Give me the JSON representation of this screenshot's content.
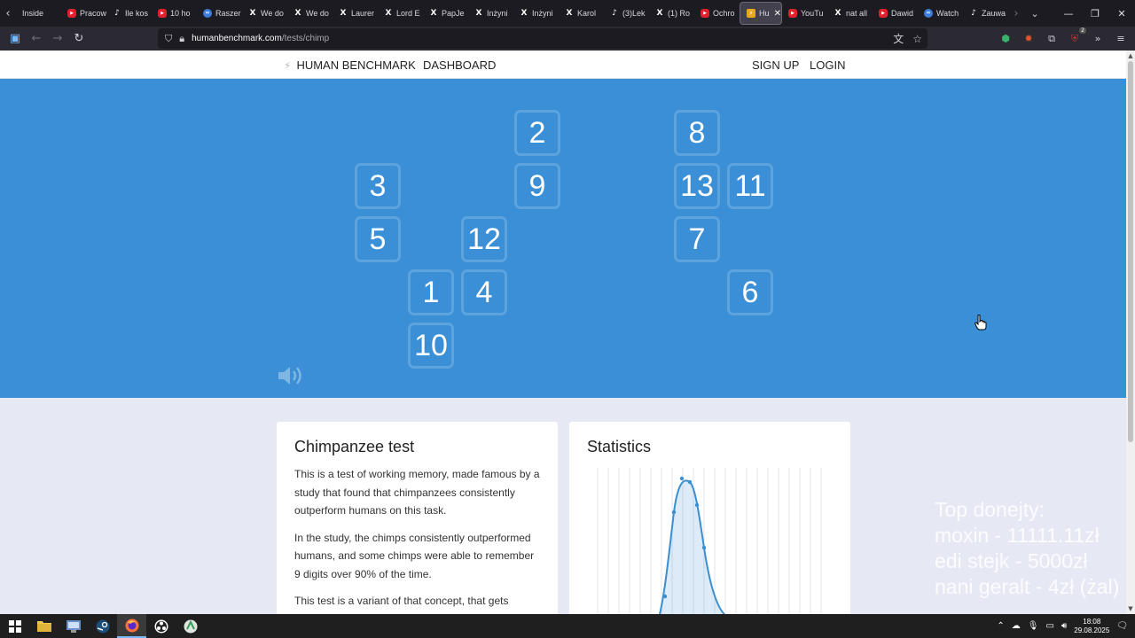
{
  "browser": {
    "tabs": [
      {
        "label": "Inside",
        "icon": "none"
      },
      {
        "label": "Pracow",
        "icon": "yt"
      },
      {
        "label": "Ile kos",
        "icon": "tt"
      },
      {
        "label": "10 ho",
        "icon": "yt"
      },
      {
        "label": "Raszer",
        "icon": "ai"
      },
      {
        "label": "We do",
        "icon": "x"
      },
      {
        "label": "We do",
        "icon": "x"
      },
      {
        "label": "Laurer",
        "icon": "x"
      },
      {
        "label": "Lord E",
        "icon": "x"
      },
      {
        "label": "PapJe",
        "icon": "x"
      },
      {
        "label": "Inżyni",
        "icon": "x"
      },
      {
        "label": "Inżyni",
        "icon": "x"
      },
      {
        "label": "Karol",
        "icon": "x"
      },
      {
        "label": "(3)Lek",
        "icon": "tt"
      },
      {
        "label": "(1) Ro",
        "icon": "x"
      },
      {
        "label": "Ochro",
        "icon": "yt"
      },
      {
        "label": "Hu",
        "icon": "hb",
        "active": true
      },
      {
        "label": "YouTu",
        "icon": "yt"
      },
      {
        "label": "nat all",
        "icon": "x"
      },
      {
        "label": "Dawid",
        "icon": "yt"
      },
      {
        "label": "Watch",
        "icon": "ai"
      },
      {
        "label": "Zauwa",
        "icon": "tt"
      }
    ],
    "url_host": "humanbenchmark.com",
    "url_path": "/tests/chimp",
    "extension_badge": "2"
  },
  "site": {
    "brand": "HUMAN BENCHMARK",
    "nav": {
      "dashboard": "DASHBOARD",
      "signup": "SIGN UP",
      "login": "LOGIN"
    }
  },
  "game": {
    "tiles": [
      {
        "n": "2",
        "col": 5,
        "row": 0
      },
      {
        "n": "8",
        "col": 8,
        "row": 0
      },
      {
        "n": "3",
        "col": 2,
        "row": 1
      },
      {
        "n": "9",
        "col": 5,
        "row": 1
      },
      {
        "n": "13",
        "col": 8,
        "row": 1
      },
      {
        "n": "11",
        "col": 9,
        "row": 1
      },
      {
        "n": "5",
        "col": 2,
        "row": 2
      },
      {
        "n": "12",
        "col": 4,
        "row": 2
      },
      {
        "n": "7",
        "col": 8,
        "row": 2
      },
      {
        "n": "1",
        "col": 3,
        "row": 3
      },
      {
        "n": "4",
        "col": 4,
        "row": 3
      },
      {
        "n": "6",
        "col": 9,
        "row": 3
      },
      {
        "n": "10",
        "col": 3,
        "row": 4
      }
    ]
  },
  "about": {
    "title": "Chimpanzee test",
    "p1": "This is a test of working memory, made famous by a study that found that chimpanzees consistently outperform humans on this task.",
    "p2": "In the study, the chimps consistently outperformed humans, and some chimps were able to remember 9 digits over 90% of the time.",
    "p3": "This test is a variant of that concept, that gets"
  },
  "stats": {
    "title": "Statistics"
  },
  "overlay": {
    "line1": "Top donejty:",
    "line2": "moxin - 11111.11zł",
    "line3": "edi stejk - 5000zł",
    "line4": "nani geralt - 4zł (żal)"
  },
  "taskbar": {
    "time": "18:08",
    "date": "29.08.2025"
  },
  "colors": {
    "arena": "#3a8fd6",
    "chart_line": "#3b8fd0"
  }
}
